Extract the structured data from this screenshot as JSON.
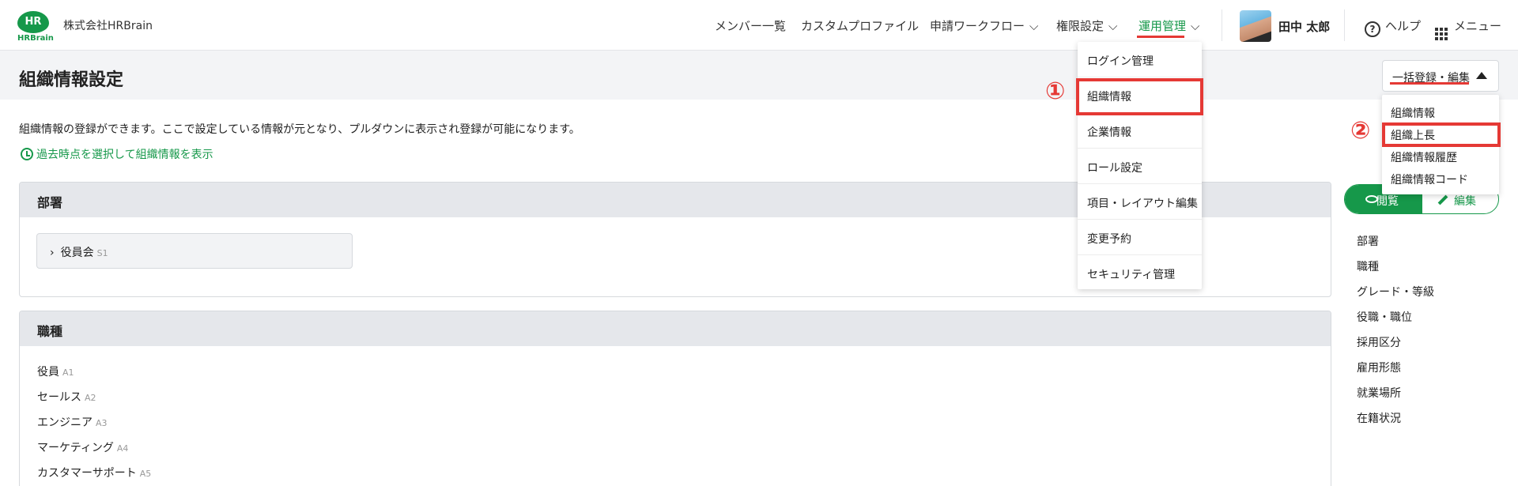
{
  "header": {
    "logo_mark": "HR",
    "logo_text": "HRBrain",
    "company": "株式会社HRBrain",
    "nav": [
      "メンバー一覧",
      "カスタムプロファイル",
      "申請ワークフロー",
      "権限設定",
      "運用管理"
    ],
    "user_name": "田中 太郎",
    "help_label": "ヘルプ",
    "menu_label": "メニュー"
  },
  "page": {
    "title": "組織情報設定",
    "bulk_button": "一括登録・編集",
    "description": "組織情報の登録ができます。ここで設定している情報が元となり、プルダウンに表示され登録が可能になります。",
    "past_link": "過去時点を選択して組織情報を表示"
  },
  "ops_dropdown": {
    "items": [
      "ログイン管理",
      "組織情報",
      "企業情報",
      "ロール設定",
      "項目・レイアウト編集",
      "変更予約",
      "セキュリティ管理"
    ]
  },
  "bulk_dropdown": {
    "items": [
      "組織情報",
      "組織上長",
      "組織情報履歴",
      "組織情報コード"
    ]
  },
  "annotations": {
    "step1": "①",
    "step2": "②"
  },
  "departments": {
    "heading": "部署",
    "tree": [
      {
        "label": "役員会",
        "code": "S1"
      }
    ]
  },
  "job_types": {
    "heading": "職種",
    "items": [
      {
        "label": "役員",
        "code": "A1"
      },
      {
        "label": "セールス",
        "code": "A2"
      },
      {
        "label": "エンジニア",
        "code": "A3"
      },
      {
        "label": "マーケティング",
        "code": "A4"
      },
      {
        "label": "カスタマーサポート",
        "code": "A5"
      }
    ]
  },
  "right_panel": {
    "view_label": "閲覧",
    "edit_label": "編集",
    "anchors": [
      "部署",
      "職種",
      "グレード・等級",
      "役職・職位",
      "採用区分",
      "雇用形態",
      "就業場所",
      "在籍状況"
    ]
  },
  "colors": {
    "brand": "#16984a",
    "highlight": "#e53935"
  }
}
